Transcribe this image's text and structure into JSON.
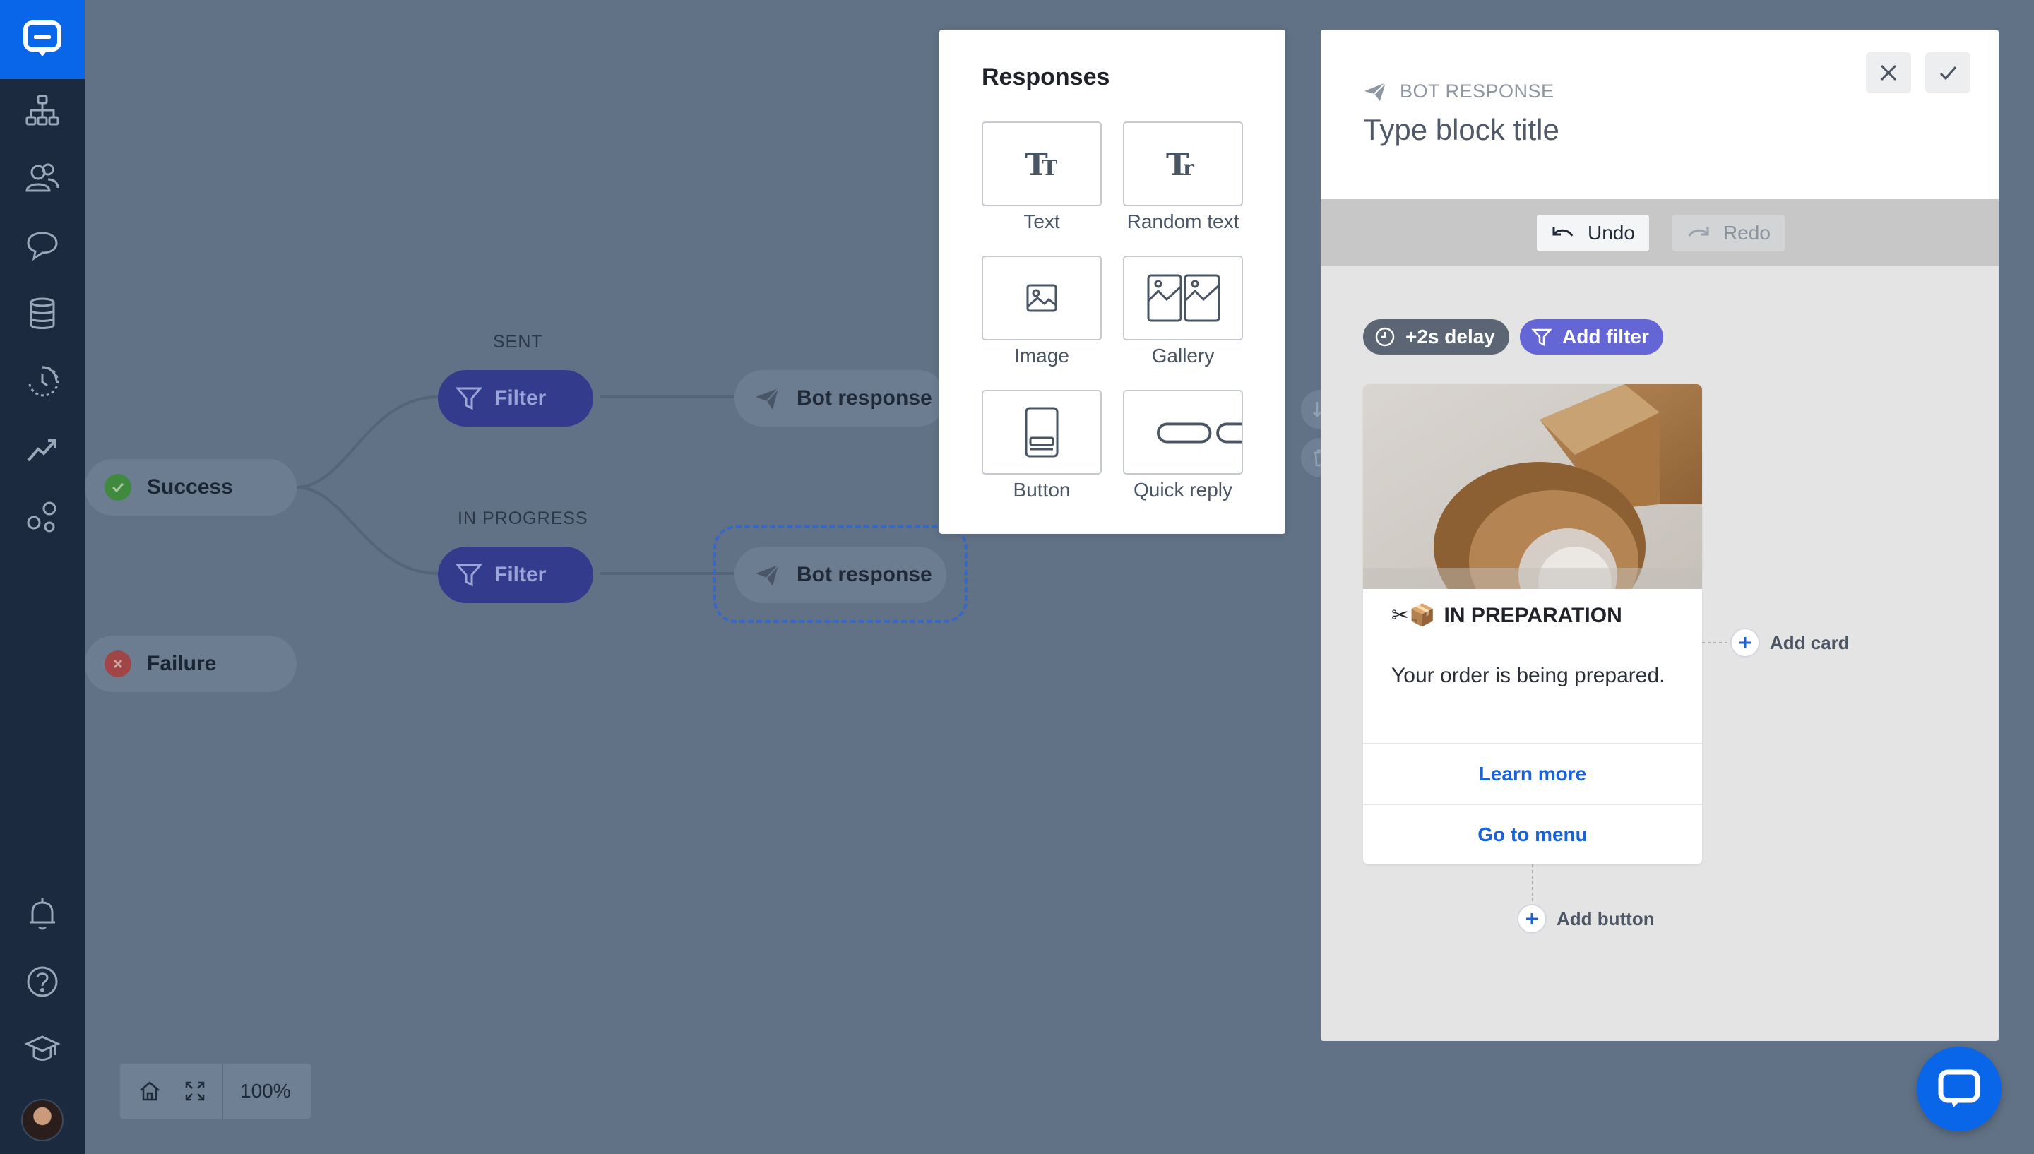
{
  "flow": {
    "success_label": "Success",
    "failure_label": "Failure",
    "sent_label": "SENT",
    "in_progress_label": "IN PROGRESS",
    "filter_label": "Filter",
    "bot_response_label": "Bot response"
  },
  "responses": {
    "title": "Responses",
    "items": [
      {
        "label": "Text",
        "icon": "text-icon"
      },
      {
        "label": "Random text",
        "icon": "random-text-icon"
      },
      {
        "label": "Image",
        "icon": "image-icon"
      },
      {
        "label": "Gallery",
        "icon": "gallery-icon"
      },
      {
        "label": "Button",
        "icon": "button-icon"
      },
      {
        "label": "Quick reply",
        "icon": "quick-reply-icon"
      }
    ]
  },
  "bot_panel": {
    "kicker": "BOT RESPONSE",
    "title_placeholder": "Type block title",
    "undo_label": "Undo",
    "redo_label": "Redo",
    "delay_chip": "+2s delay",
    "filter_chip": "Add filter",
    "card": {
      "emoji": "✂📦",
      "title": "IN PREPARATION",
      "text": "Your order is being prepared.",
      "buttons": [
        "Learn more",
        "Go to menu"
      ]
    },
    "add_card_label": "Add card",
    "add_button_label": "Add button"
  },
  "zoom": {
    "value": "100%"
  },
  "colors": {
    "brand": "#0a66e8",
    "sidebar": "#1c2a3f",
    "canvas": "#627286",
    "filter": "#333c8c",
    "chip_filter": "#6566d6",
    "link": "#1a63d6"
  }
}
